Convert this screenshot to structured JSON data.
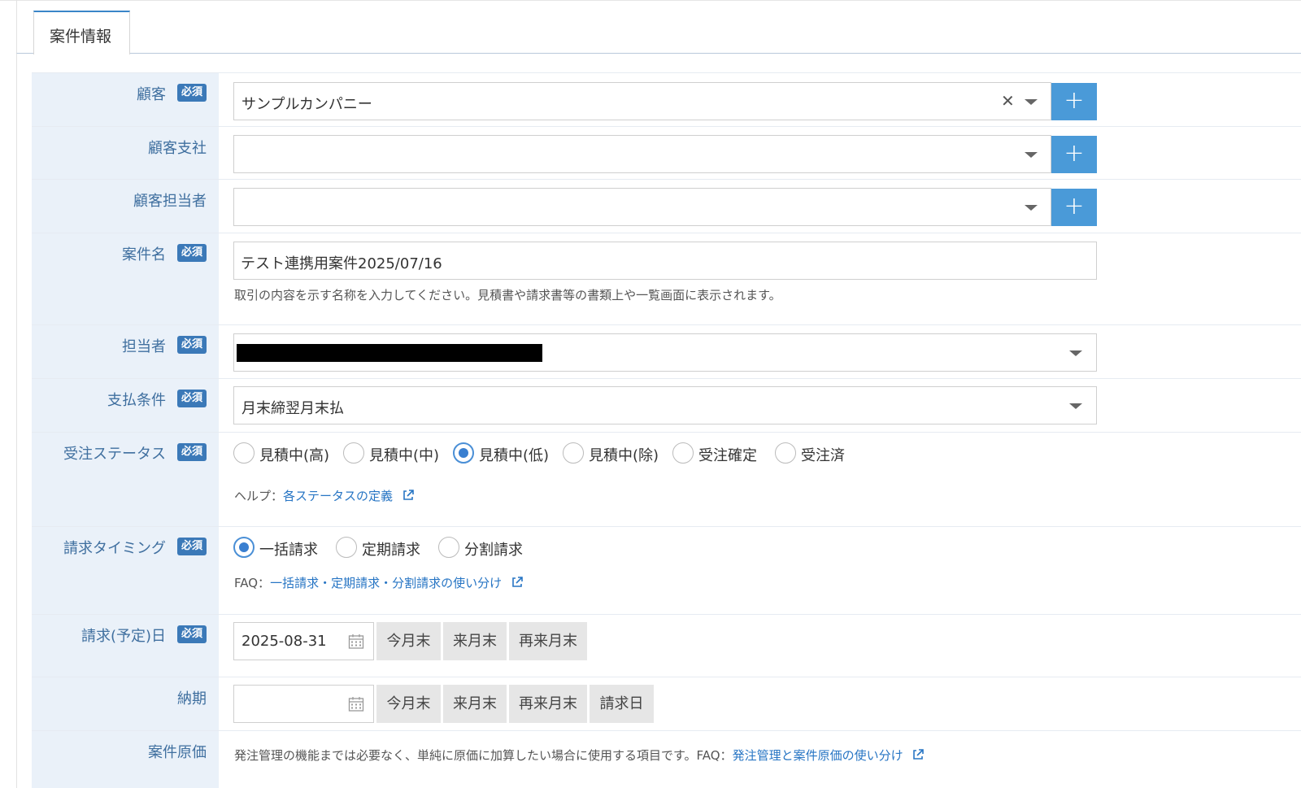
{
  "tab": {
    "label": "案件情報"
  },
  "required_badge": "必須",
  "fields": {
    "customer": {
      "label": "顧客",
      "value": "サンプルカンパニー"
    },
    "branch": {
      "label": "顧客支社",
      "value": ""
    },
    "contact": {
      "label": "顧客担当者",
      "value": ""
    },
    "project_name": {
      "label": "案件名",
      "value": "テスト連携用案件2025/07/16",
      "hint": "取引の内容を示す名称を入力してください。見積書や請求書等の書類上や一覧画面に表示されます。"
    },
    "owner": {
      "label": "担当者"
    },
    "payment_terms": {
      "label": "支払条件",
      "value": "月末締翌月末払"
    },
    "order_status": {
      "label": "受注ステータス",
      "options": [
        "見積中(高)",
        "見積中(中)",
        "見積中(低)",
        "見積中(除)",
        "受注確定",
        "受注済"
      ],
      "selected": "見積中(低)",
      "help_prefix": "ヘルプ：",
      "help_link": "各ステータスの定義"
    },
    "billing_timing": {
      "label": "請求タイミング",
      "options": [
        "一括請求",
        "定期請求",
        "分割請求"
      ],
      "selected": "一括請求",
      "faq_prefix": "FAQ：",
      "faq_link": "一括請求・定期請求・分割請求の使い分け"
    },
    "billing_date": {
      "label": "請求(予定)日",
      "value": "2025-08-31",
      "buttons": [
        "今月末",
        "来月末",
        "再来月末"
      ]
    },
    "delivery": {
      "label": "納期",
      "value": "",
      "buttons": [
        "今月末",
        "来月末",
        "再来月末",
        "請求日"
      ]
    },
    "cost": {
      "label": "案件原価",
      "hint": "発注管理の機能までは必要なく、単純に原価に加算したい場合に使用する項目です。FAQ：",
      "faq_link": "発注管理と案件原価の使い分け"
    }
  },
  "colors": {
    "accent": "#4a9ad8",
    "label_bg": "#eaf1f9",
    "label_text": "#3f6f9f",
    "link": "#2775c4"
  }
}
